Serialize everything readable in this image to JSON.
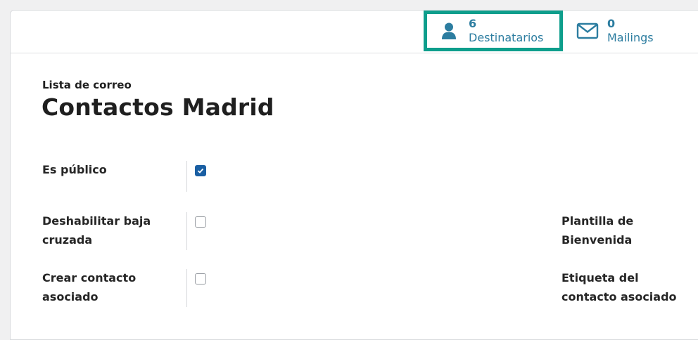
{
  "smart_buttons": [
    {
      "value": "6",
      "label": "Destinatarios",
      "icon": "user-icon",
      "highlighted": true
    },
    {
      "value": "0",
      "label": "Mailings",
      "icon": "envelope-icon",
      "highlighted": false
    }
  ],
  "record": {
    "breadcrumb": "Lista de correo",
    "title": "Contactos Madrid"
  },
  "fields": {
    "es_publico": {
      "label": "Es público",
      "checked": true
    },
    "deshabilitar": {
      "label_line1": "Deshabilitar baja",
      "label_line2": "cruzada",
      "checked": false
    },
    "crear_contacto": {
      "label_line1": "Crear contacto",
      "label_line2": "asociado",
      "checked": false
    },
    "plantilla": {
      "label_line1": "Plantilla de",
      "label_line2": "Bienvenida"
    },
    "etiqueta": {
      "label_line1": "Etiqueta del",
      "label_line2": "contacto asociado"
    }
  },
  "colors": {
    "accent": "#2c7da0",
    "highlight": "#0e9e8c",
    "checkbox_checked": "#1a5fa3"
  }
}
